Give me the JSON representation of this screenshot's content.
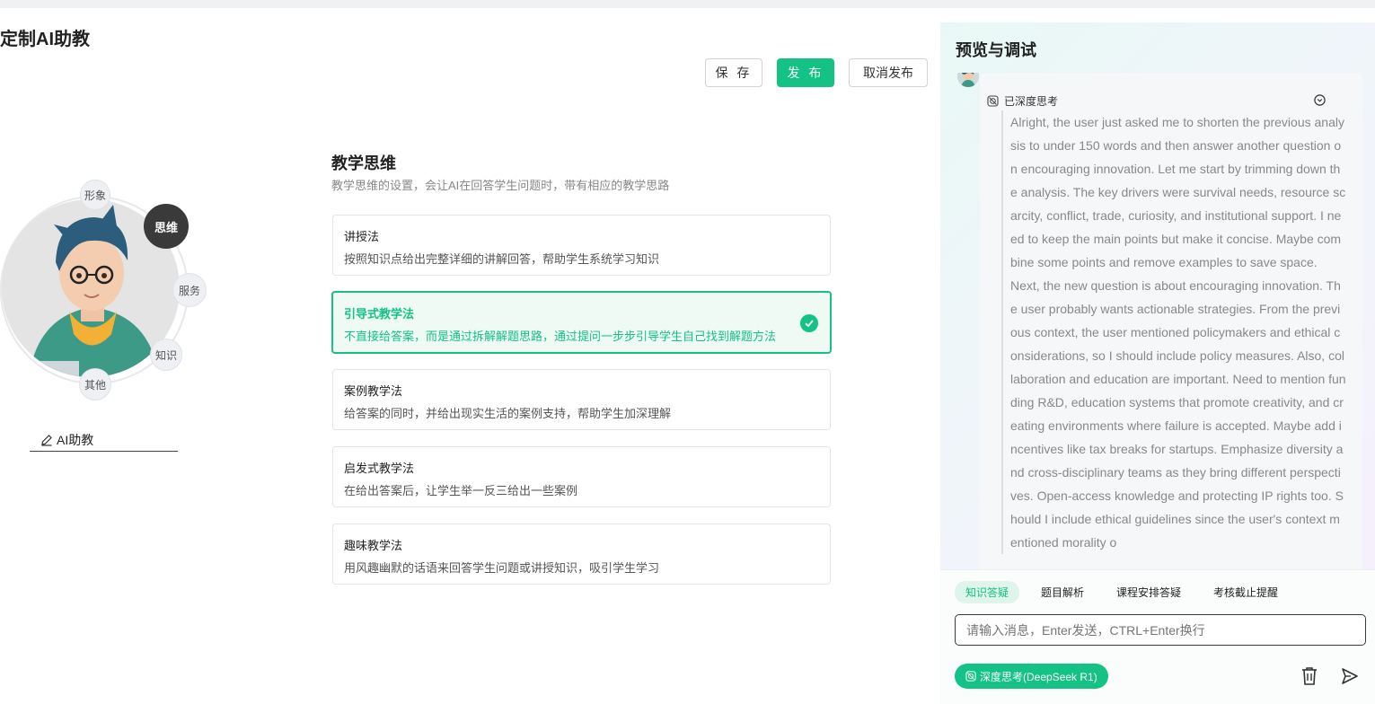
{
  "page": {
    "title": "定制AI助教"
  },
  "toolbar": {
    "save_label": "保 存",
    "publish_label": "发 布",
    "cancel_publish_label": "取消发布"
  },
  "avatar": {
    "nodes": {
      "image": "形象",
      "thinking": "思维",
      "service": "服务",
      "knowledge": "知识",
      "other": "其他"
    },
    "active_node": "思维",
    "name": "AI助教"
  },
  "teaching": {
    "title": "教学思维",
    "description": "教学思维的设置，会让AI在回答学生问题时，带有相应的教学思路",
    "selected_index": 1,
    "methods": [
      {
        "title": "讲授法",
        "desc": "按照知识点给出完整详细的讲解回答，帮助学生系统学习知识"
      },
      {
        "title": "引导式教学法",
        "desc": "不直接给答案，而是通过拆解解题思路，通过提问一步步引导学生自己找到解题方法"
      },
      {
        "title": "案例教学法",
        "desc": "给答案的同时，并给出现实生活的案例支持，帮助学生加深理解"
      },
      {
        "title": "启发式教学法",
        "desc": "在给出答案后，让学生举一反三给出一些案例"
      },
      {
        "title": "趣味教学法",
        "desc": "用风趣幽默的话语来回答学生问题或讲授知识，吸引学生学习"
      }
    ]
  },
  "preview": {
    "title": "预览与调试",
    "thinking_label": "已深度思考",
    "thinking_paragraphs": [
      "Alright, the user just asked me to shorten the previous analysis to under 150 words and then answer another question on encouraging innovation. Let me start by trimming down the analysis. The key drivers were survival needs, resource scarcity, conflict, trade, curiosity, and institutional support. I need to keep the main points but make it concise. Maybe combine some points and remove examples to save space.",
      "Next, the new question is about encouraging innovation. The user probably wants actionable strategies. From the previous context, the user mentioned policymakers and ethical considerations, so I should include policy measures. Also, collaboration and education are important. Need to mention funding R&D, education systems that promote creativity, and creating environments where failure is accepted. Maybe add incentives like tax breaks for startups. Emphasize diversity and cross-disciplinary teams as they bring different perspectives. Open-access knowledge and protecting IP rights too. Should I include ethical guidelines since the user's context mentioned morality o"
    ],
    "quick_tags": [
      "知识答疑",
      "题目解析",
      "课程安排答疑",
      "考核截止提醒"
    ],
    "active_tag_index": 0,
    "input_placeholder": "请输入消息，Enter发送，CTRL+Enter换行",
    "deep_think_label": "深度思考(DeepSeek R1)"
  },
  "colors": {
    "accent": "#14c285",
    "dark_node": "#3a3a3a"
  }
}
